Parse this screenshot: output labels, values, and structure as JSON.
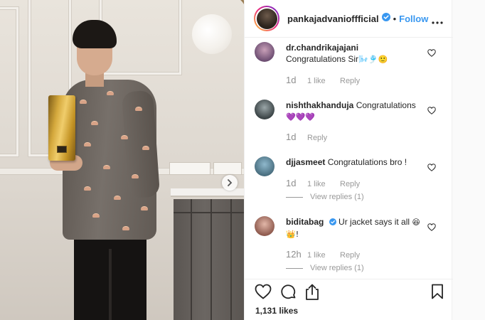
{
  "post": {
    "username": "pankajadvanioffficial",
    "follow_label": "Follow",
    "dot": "•",
    "likes_count": "1,131 likes",
    "accent_color": "#3897f0"
  },
  "comments": [
    {
      "username": "dr.chandrikajajani",
      "text": "Congratulations Sir",
      "emoji": "🌬️🎐🙂",
      "age": "1d",
      "likes": "1 like",
      "reply_label": "Reply",
      "view_replies": ""
    },
    {
      "username": "nishthakhanduja",
      "text": "Congratulations",
      "emoji": "💜💜💜",
      "age": "1d",
      "likes": "",
      "reply_label": "Reply",
      "view_replies": ""
    },
    {
      "username": "djjasmeet",
      "text": "Congratulations bro !",
      "emoji": "",
      "age": "1d",
      "likes": "1 like",
      "reply_label": "Reply",
      "view_replies": "View replies (1)"
    },
    {
      "username": "biditabag",
      "text": "Ur jacket says it all",
      "emoji": "😆",
      "emoji2": "👑!",
      "age": "12h",
      "likes": "1 like",
      "reply_label": "Reply",
      "view_replies": "View replies (1)"
    }
  ],
  "icons": {
    "more": "more-options-icon",
    "verified": "verified-badge-icon",
    "heart": "heart-icon",
    "comment": "comment-icon",
    "share": "share-icon",
    "save": "bookmark-icon",
    "next": "chevron-right-icon"
  }
}
